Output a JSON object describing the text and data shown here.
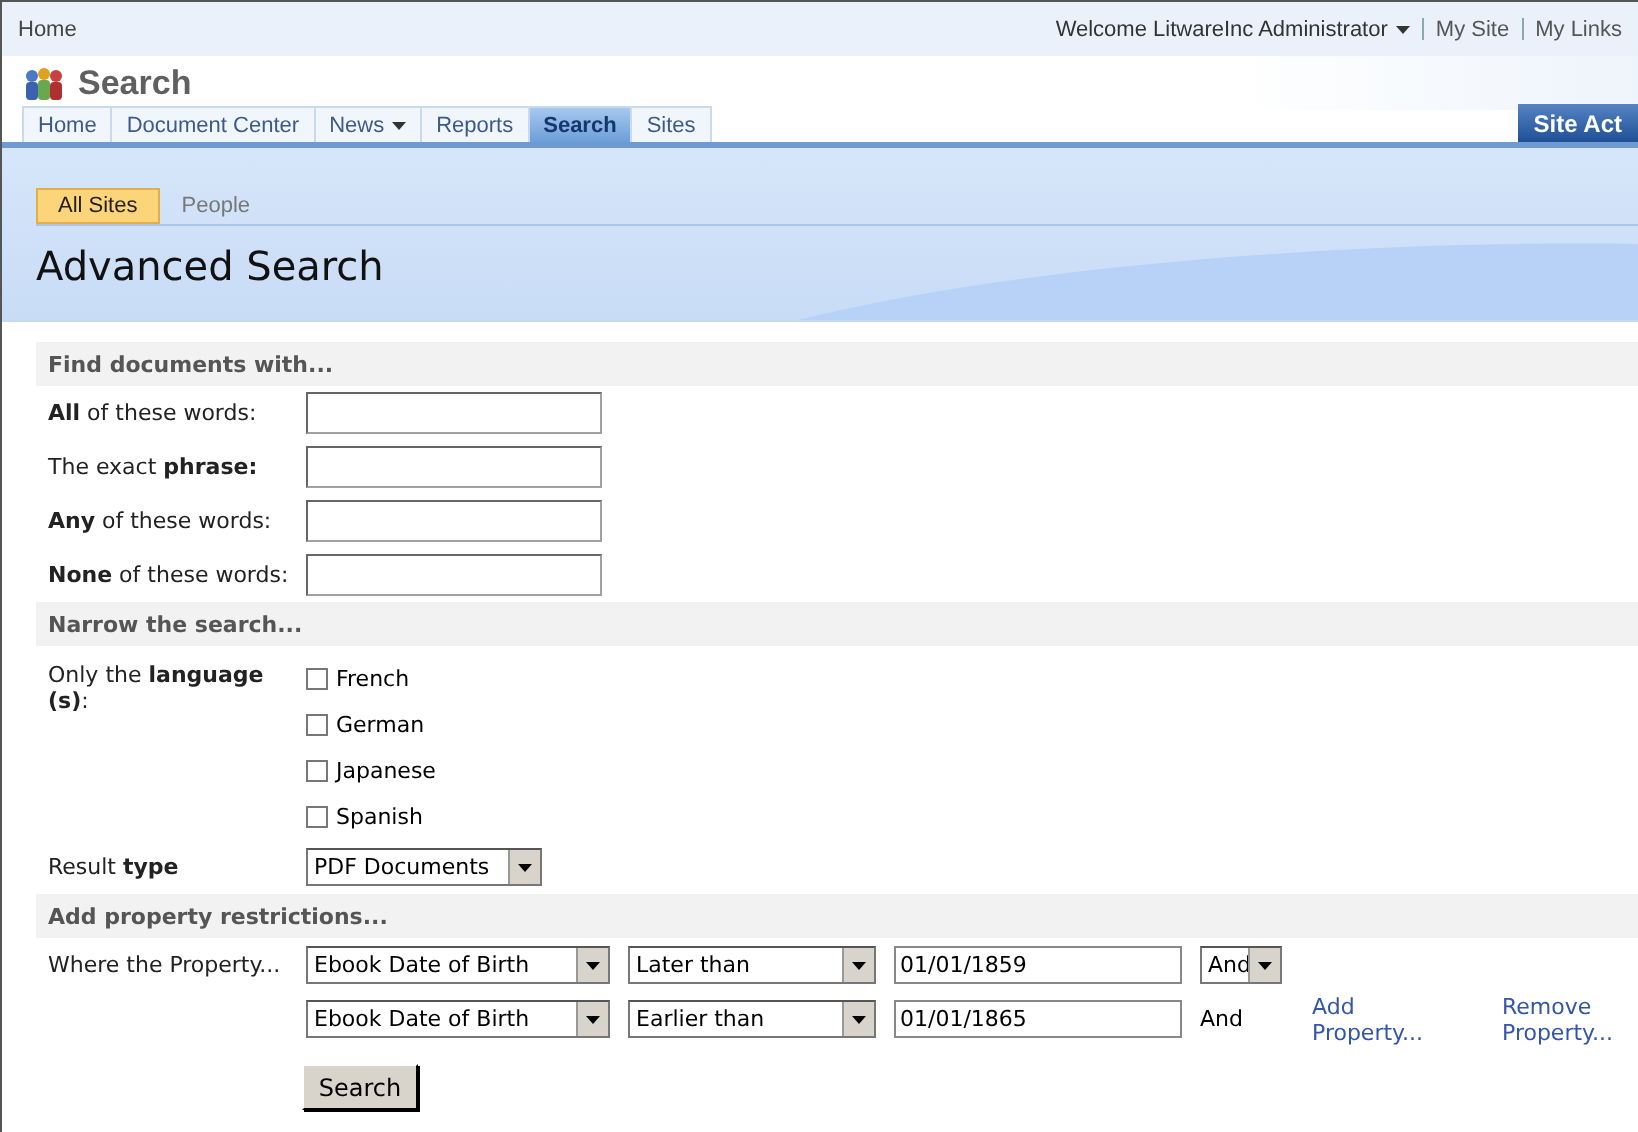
{
  "breadcrumb": "Home",
  "user_menu": {
    "label": "Welcome LitwareInc Administrator"
  },
  "top_links": [
    "My Site",
    "My Links"
  ],
  "site_title": "Search",
  "nav_tabs": [
    {
      "label": "Home",
      "selected": false,
      "dropdown": false
    },
    {
      "label": "Document Center",
      "selected": false,
      "dropdown": false
    },
    {
      "label": "News",
      "selected": false,
      "dropdown": true
    },
    {
      "label": "Reports",
      "selected": false,
      "dropdown": false
    },
    {
      "label": "Search",
      "selected": true,
      "dropdown": false
    },
    {
      "label": "Sites",
      "selected": false,
      "dropdown": false
    }
  ],
  "site_actions": "Site Act",
  "scope_tabs": [
    {
      "label": "All Sites",
      "selected": true
    },
    {
      "label": "People",
      "selected": false
    }
  ],
  "page_title": "Advanced Search",
  "find_section": {
    "heading": "Find documents with...",
    "fields": [
      {
        "label": "**All** of these words:"
      },
      {
        "label": "The exact **phrase:**"
      },
      {
        "label": "**Any** of these words:"
      },
      {
        "label": "**None** of these words:"
      }
    ]
  },
  "narrow_section": {
    "heading": "Narrow the search...",
    "language_label": "Only the **language (s)**:",
    "languages": [
      {
        "label": "French",
        "checked": false
      },
      {
        "label": "German",
        "checked": false
      },
      {
        "label": "Japanese",
        "checked": false
      },
      {
        "label": "Spanish",
        "checked": false
      }
    ],
    "result_type": {
      "label": "Result **type**",
      "value": "PDF Documents"
    }
  },
  "property_section": {
    "heading": "Add property restrictions...",
    "row_label": "Where the Property...",
    "rows": [
      {
        "property": "Ebook Date of Birth",
        "operator": "Later than",
        "value": "01/01/1859",
        "joiner": "And",
        "joiner_dropdown": true
      },
      {
        "property": "Ebook Date of Birth",
        "operator": "Earlier than",
        "value": "01/01/1865",
        "joiner": "And",
        "joiner_dropdown": false
      }
    ],
    "add_link": "Add Property...",
    "remove_link": "Remove Property..."
  },
  "search_button": "Search"
}
